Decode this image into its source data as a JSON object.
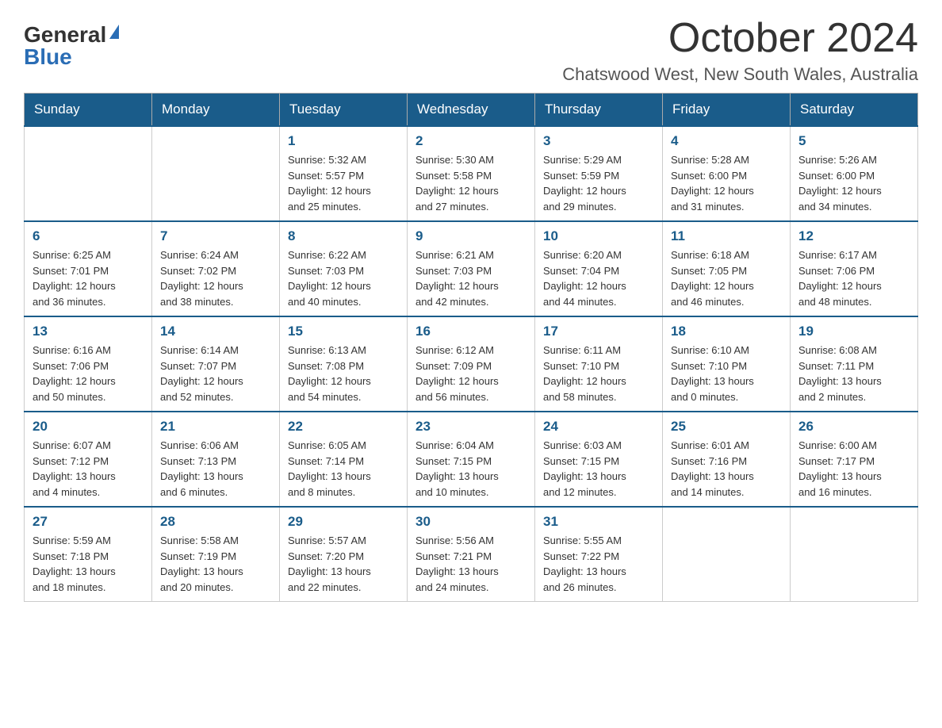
{
  "logo": {
    "general": "General",
    "blue": "Blue"
  },
  "title": "October 2024",
  "subtitle": "Chatswood West, New South Wales, Australia",
  "days_of_week": [
    "Sunday",
    "Monday",
    "Tuesday",
    "Wednesday",
    "Thursday",
    "Friday",
    "Saturday"
  ],
  "weeks": [
    [
      {
        "day": "",
        "info": ""
      },
      {
        "day": "",
        "info": ""
      },
      {
        "day": "1",
        "info": "Sunrise: 5:32 AM\nSunset: 5:57 PM\nDaylight: 12 hours\nand 25 minutes."
      },
      {
        "day": "2",
        "info": "Sunrise: 5:30 AM\nSunset: 5:58 PM\nDaylight: 12 hours\nand 27 minutes."
      },
      {
        "day": "3",
        "info": "Sunrise: 5:29 AM\nSunset: 5:59 PM\nDaylight: 12 hours\nand 29 minutes."
      },
      {
        "day": "4",
        "info": "Sunrise: 5:28 AM\nSunset: 6:00 PM\nDaylight: 12 hours\nand 31 minutes."
      },
      {
        "day": "5",
        "info": "Sunrise: 5:26 AM\nSunset: 6:00 PM\nDaylight: 12 hours\nand 34 minutes."
      }
    ],
    [
      {
        "day": "6",
        "info": "Sunrise: 6:25 AM\nSunset: 7:01 PM\nDaylight: 12 hours\nand 36 minutes."
      },
      {
        "day": "7",
        "info": "Sunrise: 6:24 AM\nSunset: 7:02 PM\nDaylight: 12 hours\nand 38 minutes."
      },
      {
        "day": "8",
        "info": "Sunrise: 6:22 AM\nSunset: 7:03 PM\nDaylight: 12 hours\nand 40 minutes."
      },
      {
        "day": "9",
        "info": "Sunrise: 6:21 AM\nSunset: 7:03 PM\nDaylight: 12 hours\nand 42 minutes."
      },
      {
        "day": "10",
        "info": "Sunrise: 6:20 AM\nSunset: 7:04 PM\nDaylight: 12 hours\nand 44 minutes."
      },
      {
        "day": "11",
        "info": "Sunrise: 6:18 AM\nSunset: 7:05 PM\nDaylight: 12 hours\nand 46 minutes."
      },
      {
        "day": "12",
        "info": "Sunrise: 6:17 AM\nSunset: 7:06 PM\nDaylight: 12 hours\nand 48 minutes."
      }
    ],
    [
      {
        "day": "13",
        "info": "Sunrise: 6:16 AM\nSunset: 7:06 PM\nDaylight: 12 hours\nand 50 minutes."
      },
      {
        "day": "14",
        "info": "Sunrise: 6:14 AM\nSunset: 7:07 PM\nDaylight: 12 hours\nand 52 minutes."
      },
      {
        "day": "15",
        "info": "Sunrise: 6:13 AM\nSunset: 7:08 PM\nDaylight: 12 hours\nand 54 minutes."
      },
      {
        "day": "16",
        "info": "Sunrise: 6:12 AM\nSunset: 7:09 PM\nDaylight: 12 hours\nand 56 minutes."
      },
      {
        "day": "17",
        "info": "Sunrise: 6:11 AM\nSunset: 7:10 PM\nDaylight: 12 hours\nand 58 minutes."
      },
      {
        "day": "18",
        "info": "Sunrise: 6:10 AM\nSunset: 7:10 PM\nDaylight: 13 hours\nand 0 minutes."
      },
      {
        "day": "19",
        "info": "Sunrise: 6:08 AM\nSunset: 7:11 PM\nDaylight: 13 hours\nand 2 minutes."
      }
    ],
    [
      {
        "day": "20",
        "info": "Sunrise: 6:07 AM\nSunset: 7:12 PM\nDaylight: 13 hours\nand 4 minutes."
      },
      {
        "day": "21",
        "info": "Sunrise: 6:06 AM\nSunset: 7:13 PM\nDaylight: 13 hours\nand 6 minutes."
      },
      {
        "day": "22",
        "info": "Sunrise: 6:05 AM\nSunset: 7:14 PM\nDaylight: 13 hours\nand 8 minutes."
      },
      {
        "day": "23",
        "info": "Sunrise: 6:04 AM\nSunset: 7:15 PM\nDaylight: 13 hours\nand 10 minutes."
      },
      {
        "day": "24",
        "info": "Sunrise: 6:03 AM\nSunset: 7:15 PM\nDaylight: 13 hours\nand 12 minutes."
      },
      {
        "day": "25",
        "info": "Sunrise: 6:01 AM\nSunset: 7:16 PM\nDaylight: 13 hours\nand 14 minutes."
      },
      {
        "day": "26",
        "info": "Sunrise: 6:00 AM\nSunset: 7:17 PM\nDaylight: 13 hours\nand 16 minutes."
      }
    ],
    [
      {
        "day": "27",
        "info": "Sunrise: 5:59 AM\nSunset: 7:18 PM\nDaylight: 13 hours\nand 18 minutes."
      },
      {
        "day": "28",
        "info": "Sunrise: 5:58 AM\nSunset: 7:19 PM\nDaylight: 13 hours\nand 20 minutes."
      },
      {
        "day": "29",
        "info": "Sunrise: 5:57 AM\nSunset: 7:20 PM\nDaylight: 13 hours\nand 22 minutes."
      },
      {
        "day": "30",
        "info": "Sunrise: 5:56 AM\nSunset: 7:21 PM\nDaylight: 13 hours\nand 24 minutes."
      },
      {
        "day": "31",
        "info": "Sunrise: 5:55 AM\nSunset: 7:22 PM\nDaylight: 13 hours\nand 26 minutes."
      },
      {
        "day": "",
        "info": ""
      },
      {
        "day": "",
        "info": ""
      }
    ]
  ]
}
